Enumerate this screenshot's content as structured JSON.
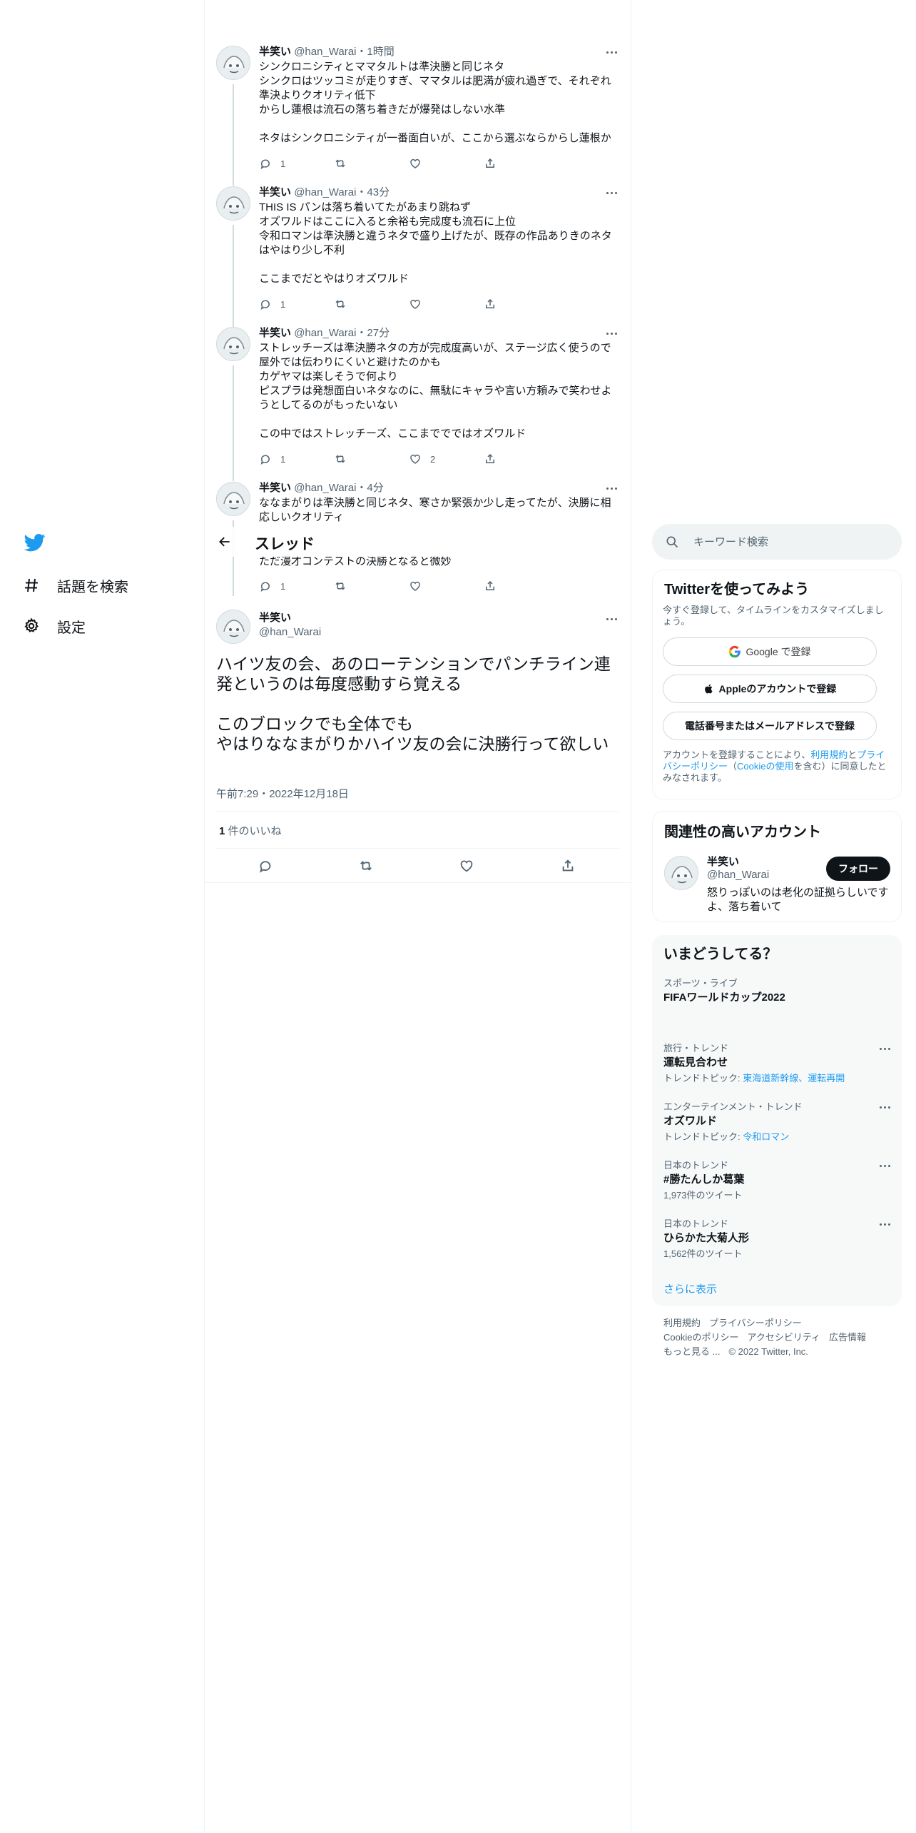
{
  "nav": {
    "logo_icon": "twitter-bird-icon",
    "explore_label": "話題を検索",
    "settings_label": "設定"
  },
  "thread_header": {
    "title": "スレッド"
  },
  "tweets": [
    {
      "name": "半笑い",
      "handle": "@han_Warai",
      "time": "1時間",
      "text": "シンクロニシティとママタルトは準決勝と同じネタ\nシンクロはツッコミが走りすぎ、ママタルは肥満が疲れ過ぎで、それぞれ準決よりクオリティ低下\nからし蓮根は流石の落ち着きだが爆発はしない水準\n\nネタはシンクロニシティが一番面白いが、ここから選ぶならからし蓮根か",
      "replies": "1",
      "retweets": "",
      "likes": ""
    },
    {
      "name": "半笑い",
      "handle": "@han_Warai",
      "time": "43分",
      "text": "THIS IS パンは落ち着いてたがあまり跳ねず\nオズワルドはここに入ると余裕も完成度も流石に上位\n令和ロマンは準決勝と違うネタで盛り上げたが、既存の作品ありきのネタはやはり少し不利\n\nここまでだとやはりオズワルド",
      "replies": "1",
      "retweets": "",
      "likes": ""
    },
    {
      "name": "半笑い",
      "handle": "@han_Warai",
      "time": "27分",
      "text": "ストレッチーズは準決勝ネタの方が完成度高いが、ステージ広く使うので屋外では伝わりにくいと避けたのかも\nカゲヤマは楽しそうで何より\nピスプラは発想面白いネタなのに、無駄にキャラや言い方頼みで笑わせようとしてるのがもったいない\n\nこの中ではストレッチーズ、ここまででではオズワルド",
      "replies": "1",
      "retweets": "",
      "likes": "2"
    },
    {
      "name": "半笑い",
      "handle": "@han_Warai",
      "time": "4分",
      "text": "ななまがりは準決勝と同じネタ、寒さか緊張か少し走ってたが、決勝に相応しいクオリティ",
      "text_tail": "ただ漫才コンテストの決勝となると微妙",
      "replies": "1",
      "retweets": "",
      "likes": ""
    }
  ],
  "focus_tweet": {
    "name": "半笑い",
    "handle": "@han_Warai",
    "text": "ハイツ友の会、あのローテンションでパンチライン連発というのは毎度感動すら覚える\n\nこのブロックでも全体でも\nやはりななまがりかハイツ友の会に決勝行って欲しい",
    "timestamp": "午前7:29・2022年12月18日",
    "like_count": "1",
    "like_label": " 件のいいね"
  },
  "search": {
    "placeholder": "キーワード検索"
  },
  "signup": {
    "title": "Twitterを使ってみよう",
    "subtitle": "今すぐ登録して、タイムラインをカスタマイズしましょう。",
    "google_label": "Google で登録",
    "apple_label": "Appleのアカウントで登録",
    "phone_label": "電話番号またはメールアドレスで登録",
    "legal_prefix": "アカウントを登録することにより、",
    "legal_link1": "利用規約",
    "legal_mid": "と",
    "legal_link2": "プライバシーポリシー",
    "legal_paren_open": "（",
    "legal_link3": "Cookieの使用",
    "legal_suffix": "を含む）に同意したとみなされます。"
  },
  "related": {
    "title": "関連性の高いアカウント",
    "name": "半笑い",
    "handle": "@han_Warai",
    "follow_label": "フォロー",
    "bio": "怒りっぽいのは老化の証拠らしいですよ、落ち着いて"
  },
  "trends": {
    "title": "いまどうしてる？",
    "items": [
      {
        "category": "スポーツ・ライブ",
        "title": "FIFAワールドカップ2022",
        "sub": "",
        "link": ""
      },
      {
        "category": "旅行・トレンド",
        "title": "運転見合わせ",
        "sub": "トレンドトピック: ",
        "link": "東海道新幹線、運転再開"
      },
      {
        "category": "エンターテインメント・トレンド",
        "title": "オズワルド",
        "sub": "トレンドトピック: ",
        "link": "令和ロマン"
      },
      {
        "category": "日本のトレンド",
        "title": "#勝たんしか葛葉",
        "sub": "1,973件のツイート",
        "link": ""
      },
      {
        "category": "日本のトレンド",
        "title": "ひらかた大菊人形",
        "sub": "1,562件のツイート",
        "link": ""
      }
    ],
    "show_more": "さらに表示"
  },
  "footer": {
    "terms": "利用規約",
    "privacy": "プライバシーポリシー",
    "cookie": "Cookieのポリシー",
    "accessibility": "アクセシビリティ",
    "ads": "広告情報",
    "more": "もっと見る ...",
    "copyright": "© 2022 Twitter, Inc."
  },
  "colors": {
    "accent": "#1d9bf0",
    "text": "#0f1419",
    "muted": "#536471",
    "border": "#eff3f4",
    "panel": "#f7f9f9"
  }
}
